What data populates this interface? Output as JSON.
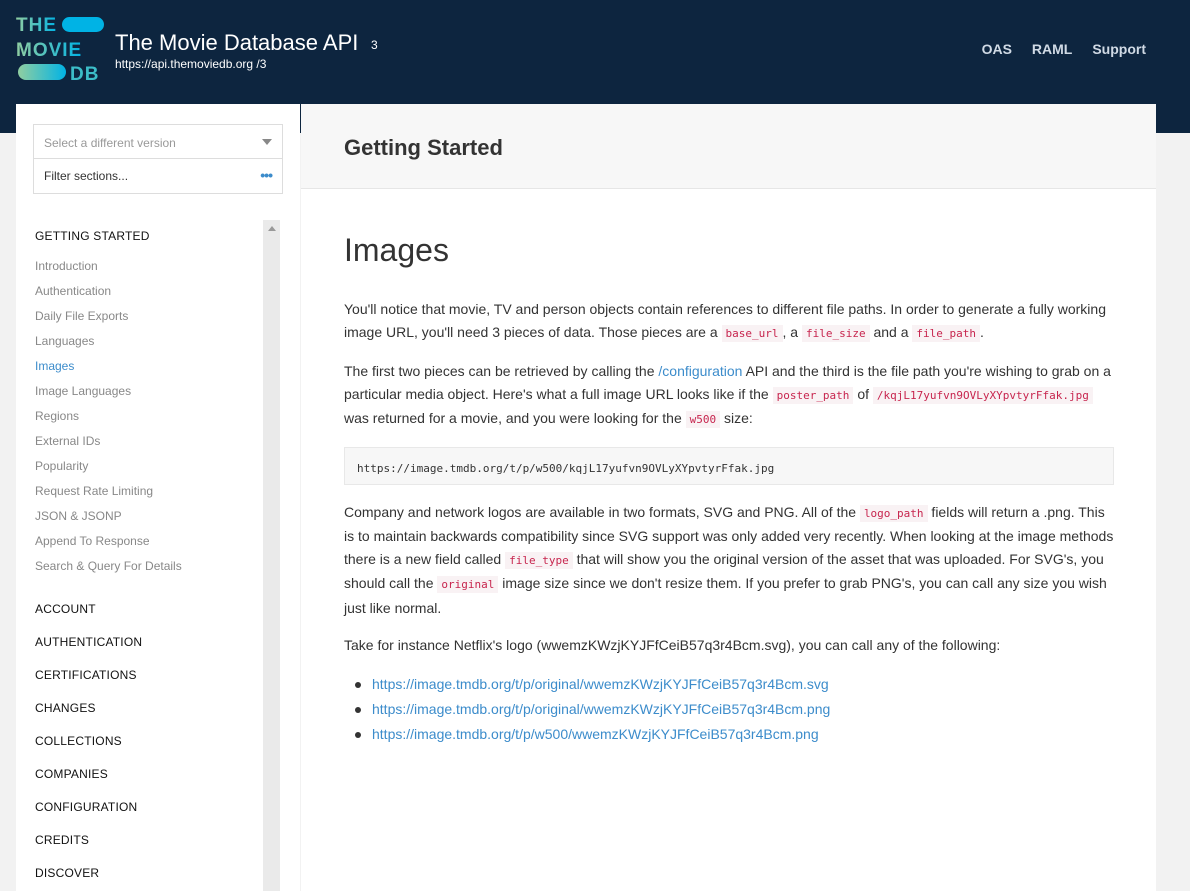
{
  "header": {
    "logo": {
      "line1": "THE",
      "line2": "MOVIE",
      "line3": "DB"
    },
    "title": "The Movie Database API",
    "version": "3",
    "url": "https://api.themoviedb.org /3",
    "nav": [
      "OAS",
      "RAML",
      "Support"
    ]
  },
  "sidebar": {
    "version_placeholder": "Select a different version",
    "filter_placeholder": "Filter sections...",
    "filter_more": "•••",
    "group": "GETTING STARTED",
    "items": [
      "Introduction",
      "Authentication",
      "Daily File Exports",
      "Languages",
      "Images",
      "Image Languages",
      "Regions",
      "External IDs",
      "Popularity",
      "Request Rate Limiting",
      "JSON & JSONP",
      "Append To Response",
      "Search & Query For Details"
    ],
    "active_item": "Images",
    "sections": [
      "ACCOUNT",
      "AUTHENTICATION",
      "CERTIFICATIONS",
      "CHANGES",
      "COLLECTIONS",
      "COMPANIES",
      "CONFIGURATION",
      "CREDITS",
      "DISCOVER"
    ]
  },
  "main": {
    "section_title": "Getting Started",
    "heading": "Images",
    "p1": {
      "a": "You'll notice that movie, TV and person objects contain references to different file paths. In order to generate a fully working image URL, you'll need 3 pieces of data. Those pieces are a ",
      "code1": "base_url",
      "b": ", a ",
      "code2": "file_size",
      "c": " and a ",
      "code3": "file_path",
      "d": "."
    },
    "p2": {
      "a": "The first two pieces can be retrieved by calling the ",
      "link": "/configuration",
      "b": " API and the third is the file path you're wishing to grab on a particular media object. Here's what a full image URL looks like if the ",
      "code1": "poster_path",
      "c": " of ",
      "code2": "/kqjL17yufvn9OVLyXYpvtyrFfak.jpg",
      "d": " was returned for a movie, and you were looking for the ",
      "code3": "w500",
      "e": " size:"
    },
    "code_block": "https://image.tmdb.org/t/p/w500/kqjL17yufvn9OVLyXYpvtyrFfak.jpg",
    "p3": {
      "a": "Company and network logos are available in two formats, SVG and PNG. All of the ",
      "code1": "logo_path",
      "b": " fields will return a .png. This is to maintain backwards compatibility since SVG support was only added very recently. When looking at the image methods there is a new field called ",
      "code2": "file_type",
      "c": " that will show you the original version of the asset that was uploaded. For SVG's, you should call the ",
      "code3": "original",
      "d": " image size since we don't resize them. If you prefer to grab PNG's, you can call any size you wish just like normal."
    },
    "p4": "Take for instance Netflix's logo (wwemzKWzjKYJFfCeiB57q3r4Bcm.svg), you can call any of the following:",
    "links": [
      "https://image.tmdb.org/t/p/original/wwemzKWzjKYJFfCeiB57q3r4Bcm.svg",
      "https://image.tmdb.org/t/p/original/wwemzKWzjKYJFfCeiB57q3r4Bcm.png",
      "https://image.tmdb.org/t/p/w500/wwemzKWzjKYJFfCeiB57q3r4Bcm.png"
    ]
  }
}
